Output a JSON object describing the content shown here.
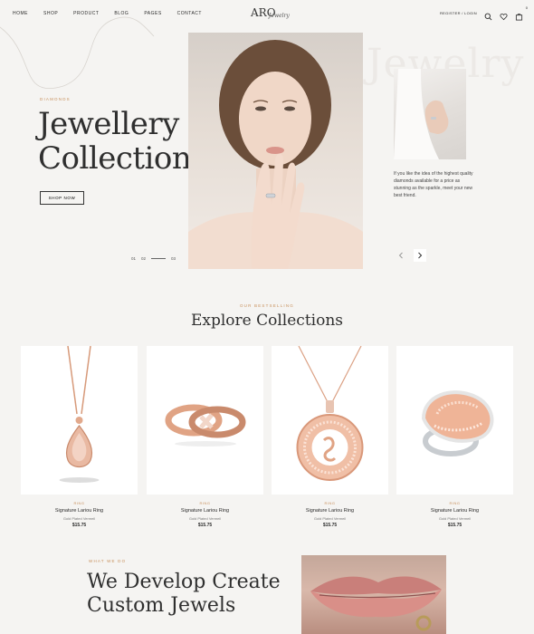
{
  "nav": {
    "links": [
      "HOME",
      "SHOP",
      "PRODUCT",
      "BLOG",
      "PAGES",
      "CONTACT"
    ],
    "logo": "ARO",
    "logo_script": "Jewelry",
    "auth": "REGISTER / LOGIN",
    "cart_count": "0",
    "icons": [
      "search-icon",
      "heart-icon",
      "cart-icon"
    ]
  },
  "hero": {
    "eyebrow": "DIAMONDS",
    "title_line1": "Jewellery",
    "title_line2": "Collection",
    "button": "SHOP NOW",
    "slide_current": "01",
    "slide_second": "02",
    "slide_total": "03",
    "watermark": "Jewelry",
    "side_text": "If you like the idea of the highest quality diamonds available for a price as stunning as the sparkle, meet your new best friend."
  },
  "collections": {
    "eyebrow": "OUR BESTSELLING",
    "title": "Explore Collections",
    "products": [
      {
        "tag": "RING",
        "name": "Signature Lariou Ring",
        "sub": "Gold Plated Vermeil",
        "price": "$15.75"
      },
      {
        "tag": "RING",
        "name": "Signature Lariou Ring",
        "sub": "Gold Plated Vermeil",
        "price": "$15.75"
      },
      {
        "tag": "RING",
        "name": "Signature Lariou Ring",
        "sub": "Gold Plated Vermeil",
        "price": "$15.75"
      },
      {
        "tag": "RING",
        "name": "Signature Lariou Ring",
        "sub": "Gold Plated Vermeil",
        "price": "$15.75"
      }
    ]
  },
  "about": {
    "eyebrow": "WHAT WE DO",
    "title_line1": "We Develop Create",
    "title_line2": "Custom Jewels"
  },
  "colors": {
    "accent": "#c8915e",
    "background": "#f5f4f2",
    "rose_gold": "#e2a98c"
  }
}
